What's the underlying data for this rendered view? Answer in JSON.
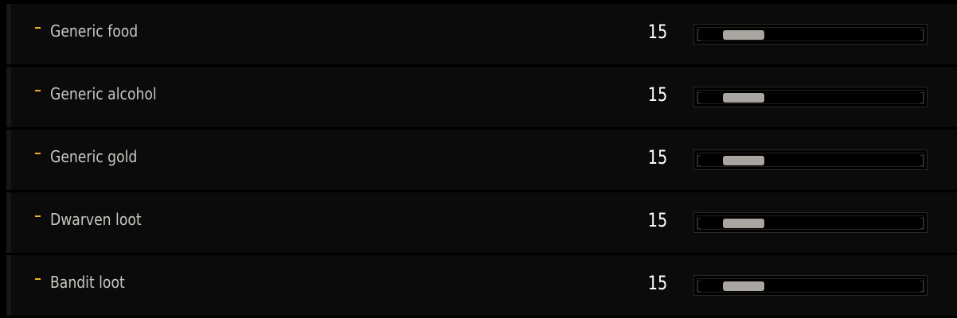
{
  "rows": [
    {
      "label": "Generic food",
      "value": "15",
      "level": 0.15
    },
    {
      "label": "Generic alcohol",
      "value": "15",
      "level": 0.15
    },
    {
      "label": "Generic gold",
      "value": "15",
      "level": 0.15
    },
    {
      "label": "Dwarven loot",
      "value": "15",
      "level": 0.15
    },
    {
      "label": "Bandit loot",
      "value": "15",
      "level": 0.15
    }
  ],
  "colors": {
    "bullet": "#f2b12a",
    "row_background": "#0b0b0b",
    "handle": "#a9a6a2"
  }
}
